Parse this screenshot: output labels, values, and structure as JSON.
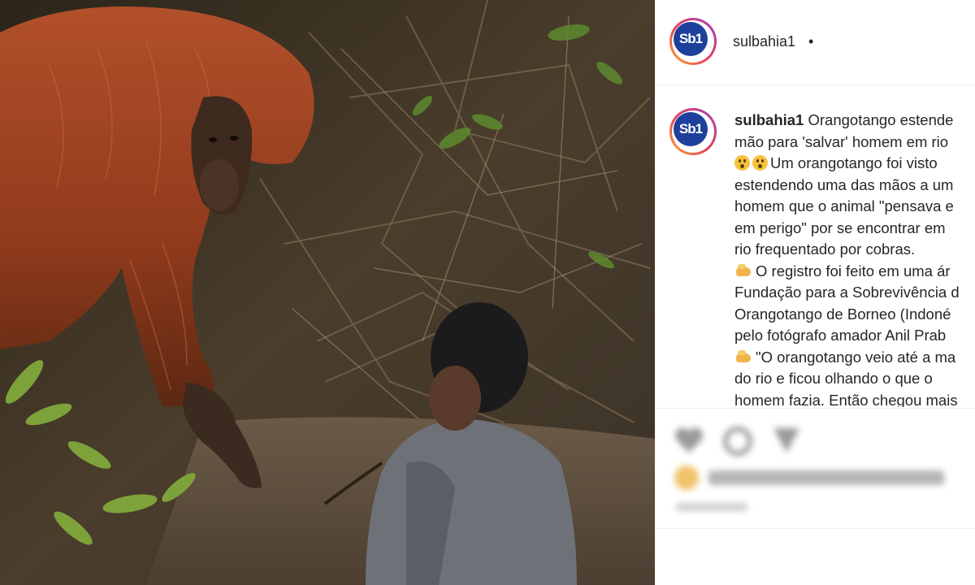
{
  "post": {
    "username": "sulbahia1",
    "separator": "•",
    "avatar_text": "Sb1",
    "caption_lines": [
      "Orangotango estende",
      "mão para 'salvar' homem em rio",
      "Um orangotango foi visto",
      "estendendo uma das mãos a um",
      "homem que o animal \"pensava e",
      "em perigo\" por se encontrar em",
      "rio frequentado por cobras.",
      "O registro foi feito em uma ár",
      "Fundação para a Sobrevivência d",
      "Orangotango de Borneo (Indoné",
      "pelo fotógrafo amador Anil Prab",
      "\"O orangotango veio até a ma",
      "do rio e ficou olhando o que o",
      "homem fazia. Então chegou mais"
    ],
    "icons": {
      "astonished": "astonished-face-emoji",
      "writing": "writing-hand-emoji",
      "pointing": "pointing-hand-emoji",
      "like": "heart-icon",
      "comment": "comment-icon",
      "share": "share-icon"
    }
  },
  "colors": {
    "brand_blue": "#1f3f9c",
    "text": "#262626",
    "ring_start": "#f9a52c",
    "ring_end": "#a43bb5"
  }
}
